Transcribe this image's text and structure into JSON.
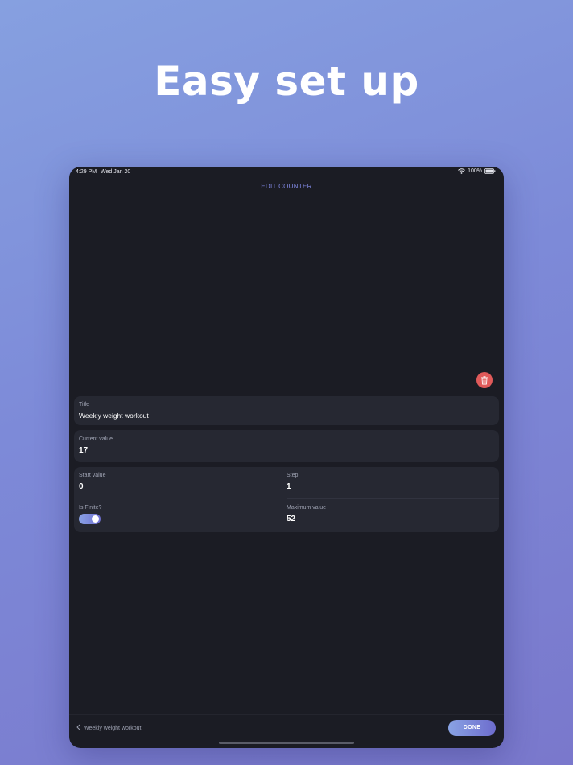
{
  "headline": "Easy set up",
  "status_bar": {
    "time": "4:29 PM",
    "date": "Wed Jan 20",
    "battery": "100%"
  },
  "nav": {
    "title": "EDIT COUNTER"
  },
  "fields": {
    "title": {
      "label": "Title",
      "value": "Weekly weight workout"
    },
    "current_value": {
      "label": "Current value",
      "value": "17"
    },
    "start_value": {
      "label": "Start value",
      "value": "0"
    },
    "step": {
      "label": "Step",
      "value": "1"
    },
    "is_finite": {
      "label": "Is Finite?",
      "on": true
    },
    "maximum_value": {
      "label": "Maximum value",
      "value": "52"
    }
  },
  "footer": {
    "back_label": "Weekly weight workout",
    "done_label": "DONE"
  },
  "colors": {
    "accent": "#7f86e0",
    "delete": "#e05a5a",
    "background": "#1b1c24",
    "card": "#262832"
  },
  "icons": [
    "wifi-icon",
    "battery-icon",
    "trash-icon",
    "chevron-left-icon"
  ]
}
